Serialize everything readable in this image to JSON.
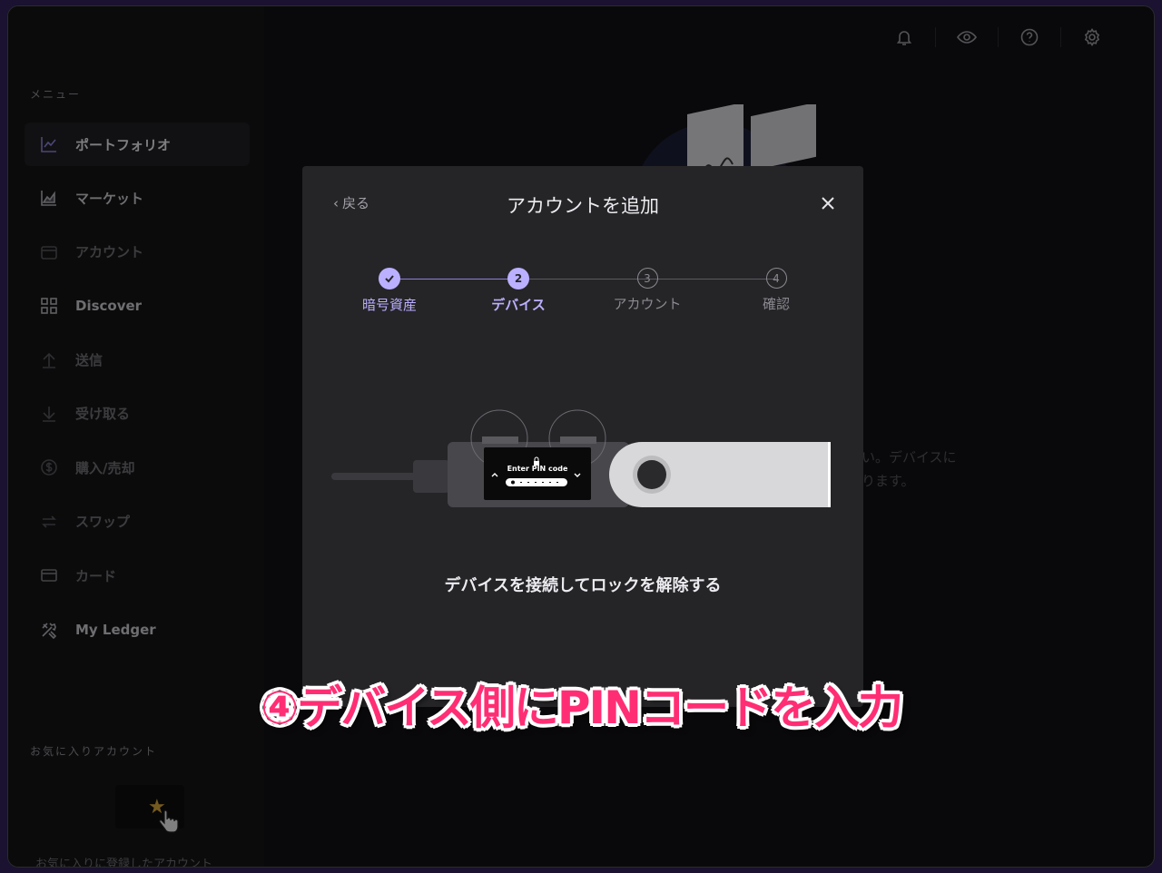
{
  "sidebar": {
    "menu_title": "メニュー",
    "items": [
      {
        "label": "ポートフォリオ",
        "icon": "chart-line-icon"
      },
      {
        "label": "マーケット",
        "icon": "market-chart-icon"
      },
      {
        "label": "アカウント",
        "icon": "wallet-icon"
      },
      {
        "label": "Discover",
        "icon": "grid-icon"
      },
      {
        "label": "送信",
        "icon": "arrow-up-icon"
      },
      {
        "label": "受け取る",
        "icon": "arrow-down-icon"
      },
      {
        "label": "購入/売却",
        "icon": "dollar-circle-icon"
      },
      {
        "label": "スワップ",
        "icon": "swap-icon"
      },
      {
        "label": "カード",
        "icon": "card-icon"
      },
      {
        "label": "My Ledger",
        "icon": "tools-icon"
      }
    ],
    "favorites_title": "お気に入りアカウント",
    "favorites_empty": "お気に入りに登録したアカウント"
  },
  "background": {
    "line1": "い。デバイスに",
    "line2": "ります。"
  },
  "modal": {
    "back_label": "戻る",
    "title": "アカウントを追加",
    "steps": [
      {
        "number": "",
        "label": "暗号資産",
        "state": "done"
      },
      {
        "number": "2",
        "label": "デバイス",
        "state": "current"
      },
      {
        "number": "3",
        "label": "アカウント",
        "state": "todo"
      },
      {
        "number": "4",
        "label": "確認",
        "state": "todo"
      }
    ],
    "device_screen_text": "Enter PIN code",
    "instruction": "デバイスを接続してロックを解除する"
  },
  "caption": "④デバイス側にPINコードを入力",
  "colors": {
    "accent": "#bbb0ff",
    "caption": "#ff2e74"
  }
}
